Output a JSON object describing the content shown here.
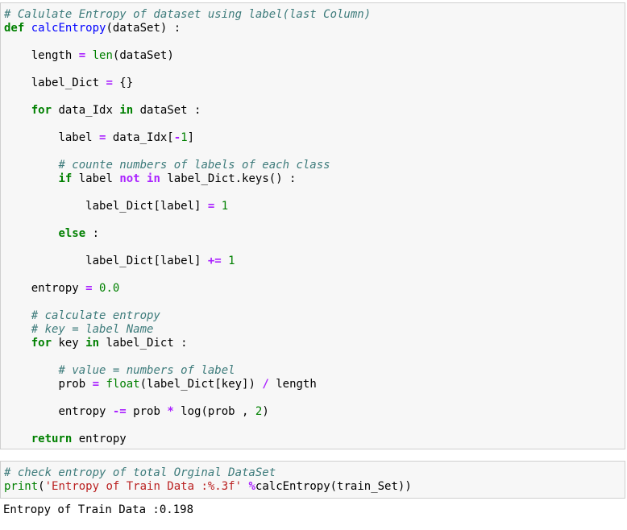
{
  "cell1": {
    "lines": [
      {
        "indent": "",
        "parts": [
          {
            "t": "cm",
            "v": "# Calulate Entropy of dataset using label(last Column)"
          }
        ]
      },
      {
        "indent": "",
        "parts": [
          {
            "t": "kw",
            "v": "def"
          },
          {
            "t": "",
            "v": " "
          },
          {
            "t": "fn",
            "v": "calcEntropy"
          },
          {
            "t": "",
            "v": "(dataSet) :"
          }
        ]
      },
      {
        "indent": "    ",
        "parts": [
          {
            "t": "",
            "v": "length "
          },
          {
            "t": "op",
            "v": "="
          },
          {
            "t": "",
            "v": " "
          },
          {
            "t": "bi",
            "v": "len"
          },
          {
            "t": "",
            "v": "(dataSet)"
          }
        ]
      },
      {
        "indent": "    ",
        "parts": [
          {
            "t": "",
            "v": "label_Dict "
          },
          {
            "t": "op",
            "v": "="
          },
          {
            "t": "",
            "v": " {}"
          }
        ]
      },
      {
        "indent": "    ",
        "parts": [
          {
            "t": "kw",
            "v": "for"
          },
          {
            "t": "",
            "v": " data_Idx "
          },
          {
            "t": "kw",
            "v": "in"
          },
          {
            "t": "",
            "v": " dataSet :"
          }
        ]
      },
      {
        "indent": "        ",
        "parts": [
          {
            "t": "",
            "v": "label "
          },
          {
            "t": "op",
            "v": "="
          },
          {
            "t": "",
            "v": " data_Idx["
          },
          {
            "t": "op",
            "v": "-"
          },
          {
            "t": "num",
            "v": "1"
          },
          {
            "t": "",
            "v": "]"
          }
        ]
      },
      {
        "indent": "        ",
        "parts": [
          {
            "t": "cm",
            "v": "# counte numbers of labels of each class"
          }
        ]
      },
      {
        "indent": "        ",
        "parts": [
          {
            "t": "kw",
            "v": "if"
          },
          {
            "t": "",
            "v": " label "
          },
          {
            "t": "op",
            "v": "not"
          },
          {
            "t": "",
            "v": " "
          },
          {
            "t": "op",
            "v": "in"
          },
          {
            "t": "",
            "v": " label_Dict.keys() :"
          }
        ]
      },
      {
        "indent": "            ",
        "parts": [
          {
            "t": "",
            "v": "label_Dict[label] "
          },
          {
            "t": "op",
            "v": "="
          },
          {
            "t": "",
            "v": " "
          },
          {
            "t": "num",
            "v": "1"
          }
        ]
      },
      {
        "indent": "        ",
        "parts": [
          {
            "t": "kw",
            "v": "else"
          },
          {
            "t": "",
            "v": " :"
          }
        ]
      },
      {
        "indent": "            ",
        "parts": [
          {
            "t": "",
            "v": "label_Dict[label] "
          },
          {
            "t": "op",
            "v": "+="
          },
          {
            "t": "",
            "v": " "
          },
          {
            "t": "num",
            "v": "1"
          }
        ]
      },
      {
        "indent": "    ",
        "parts": [
          {
            "t": "",
            "v": "entropy "
          },
          {
            "t": "op",
            "v": "="
          },
          {
            "t": "",
            "v": " "
          },
          {
            "t": "num",
            "v": "0.0"
          }
        ]
      },
      {
        "indent": "    ",
        "parts": [
          {
            "t": "cm",
            "v": "# calculate entropy"
          }
        ]
      },
      {
        "indent": "    ",
        "parts": [
          {
            "t": "cm",
            "v": "# key = label Name"
          }
        ]
      },
      {
        "indent": "    ",
        "parts": [
          {
            "t": "kw",
            "v": "for"
          },
          {
            "t": "",
            "v": " key "
          },
          {
            "t": "kw",
            "v": "in"
          },
          {
            "t": "",
            "v": " label_Dict :"
          }
        ]
      },
      {
        "indent": "        ",
        "parts": [
          {
            "t": "cm",
            "v": "# value = numbers of label"
          }
        ]
      },
      {
        "indent": "        ",
        "parts": [
          {
            "t": "",
            "v": "prob "
          },
          {
            "t": "op",
            "v": "="
          },
          {
            "t": "",
            "v": " "
          },
          {
            "t": "bi",
            "v": "float"
          },
          {
            "t": "",
            "v": "(label_Dict[key]) "
          },
          {
            "t": "op",
            "v": "/"
          },
          {
            "t": "",
            "v": " length"
          }
        ]
      },
      {
        "indent": "        ",
        "parts": [
          {
            "t": "",
            "v": "entropy "
          },
          {
            "t": "op",
            "v": "-="
          },
          {
            "t": "",
            "v": " prob "
          },
          {
            "t": "op",
            "v": "*"
          },
          {
            "t": "",
            "v": " log(prob , "
          },
          {
            "t": "num",
            "v": "2"
          },
          {
            "t": "",
            "v": ")"
          }
        ]
      },
      {
        "indent": "    ",
        "parts": [
          {
            "t": "kw",
            "v": "return"
          },
          {
            "t": "",
            "v": " entropy"
          }
        ]
      }
    ]
  },
  "cell2": {
    "lines": [
      {
        "indent": "",
        "parts": [
          {
            "t": "cm",
            "v": "# check entropy of total Orginal DataSet"
          }
        ]
      },
      {
        "indent": "",
        "parts": [
          {
            "t": "bi",
            "v": "print"
          },
          {
            "t": "",
            "v": "("
          },
          {
            "t": "str",
            "v": "'Entropy of Train Data :%.3f'"
          },
          {
            "t": "",
            "v": " "
          },
          {
            "t": "op",
            "v": "%"
          },
          {
            "t": "",
            "v": "calcEntropy(train_Set))"
          }
        ]
      }
    ]
  },
  "output": {
    "text": "Entropy of Train Data :0.198"
  }
}
